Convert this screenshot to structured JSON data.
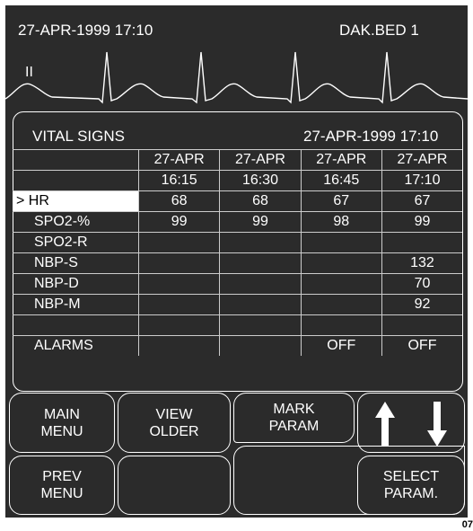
{
  "header": {
    "datetime": "27-APR-1999  17:10",
    "bed": "DAK.BED 1"
  },
  "ecg": {
    "lead": "II"
  },
  "vitals": {
    "title": "VITAL SIGNS",
    "datetime": "27-APR-1999  17:10",
    "columns": [
      {
        "date": "27-APR",
        "time": "16:15"
      },
      {
        "date": "27-APR",
        "time": "16:30"
      },
      {
        "date": "27-APR",
        "time": "16:45"
      },
      {
        "date": "27-APR",
        "time": "17:10"
      }
    ],
    "rows": [
      {
        "label": "> HR",
        "values": [
          "68",
          "68",
          "67",
          "67"
        ]
      },
      {
        "label": "SPO2-%",
        "values": [
          "99",
          "99",
          "98",
          "99"
        ]
      },
      {
        "label": "SPO2-R",
        "values": [
          "",
          "",
          "",
          ""
        ]
      },
      {
        "label": "NBP-S",
        "values": [
          "",
          "",
          "",
          "132"
        ]
      },
      {
        "label": "NBP-D",
        "values": [
          "",
          "",
          "",
          "70"
        ]
      },
      {
        "label": "NBP-M",
        "values": [
          "",
          "",
          "",
          "92"
        ]
      },
      {
        "label": "",
        "values": [
          "",
          "",
          "",
          ""
        ]
      },
      {
        "label": "ALARMS",
        "values": [
          "",
          "",
          "OFF",
          "OFF"
        ]
      }
    ]
  },
  "buttons": {
    "main_menu": "MAIN\nMENU",
    "view_older": "VIEW\nOLDER",
    "mark_param": "MARK\nPARAM",
    "prev_menu": "PREV\nMENU",
    "select_param": "SELECT\nPARAM."
  },
  "icons": {
    "up": "arrow-up-icon",
    "down": "arrow-down-icon"
  },
  "footer": {
    "code": "07"
  }
}
